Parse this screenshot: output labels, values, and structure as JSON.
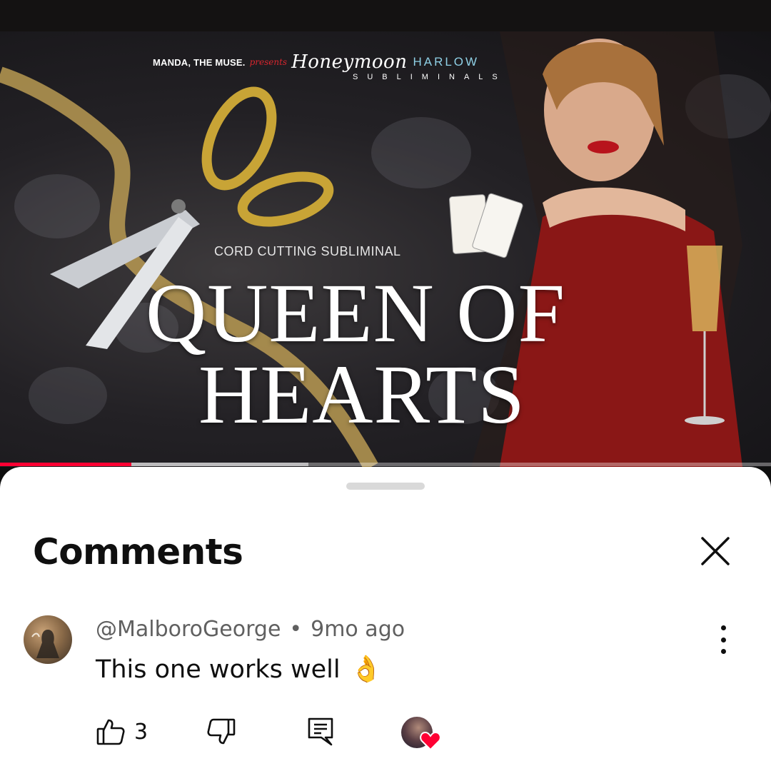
{
  "video": {
    "brand": "MANDA, THE MUSE.",
    "presents": "presents",
    "logo_script": "Honeymoon",
    "logo_word": "HARLOW",
    "logo_sub": "SUBLIMINALS",
    "subtitle": "CORD CUTTING SUBLIMINAL",
    "title_line1": "QUEEN OF",
    "title_line2": "HEARTS",
    "progress_played": 0.17,
    "progress_buffered": 0.4
  },
  "comments_sheet": {
    "title": "Comments",
    "close_icon": "close-icon"
  },
  "comment": {
    "author": "@MalboroGeorge",
    "separator": "•",
    "time": "9mo ago",
    "text": "This one works well",
    "emoji": "👌",
    "like_count": "3"
  },
  "icons": {
    "like": "thumbs-up-icon",
    "dislike": "thumbs-down-icon",
    "reply": "reply-icon",
    "more": "more-vertical-icon",
    "creator_heart": "heart-icon"
  },
  "colors": {
    "accent": "#ff0033",
    "heart": "#ff0033",
    "text_primary": "#0f0f0f",
    "text_secondary": "#606060"
  }
}
